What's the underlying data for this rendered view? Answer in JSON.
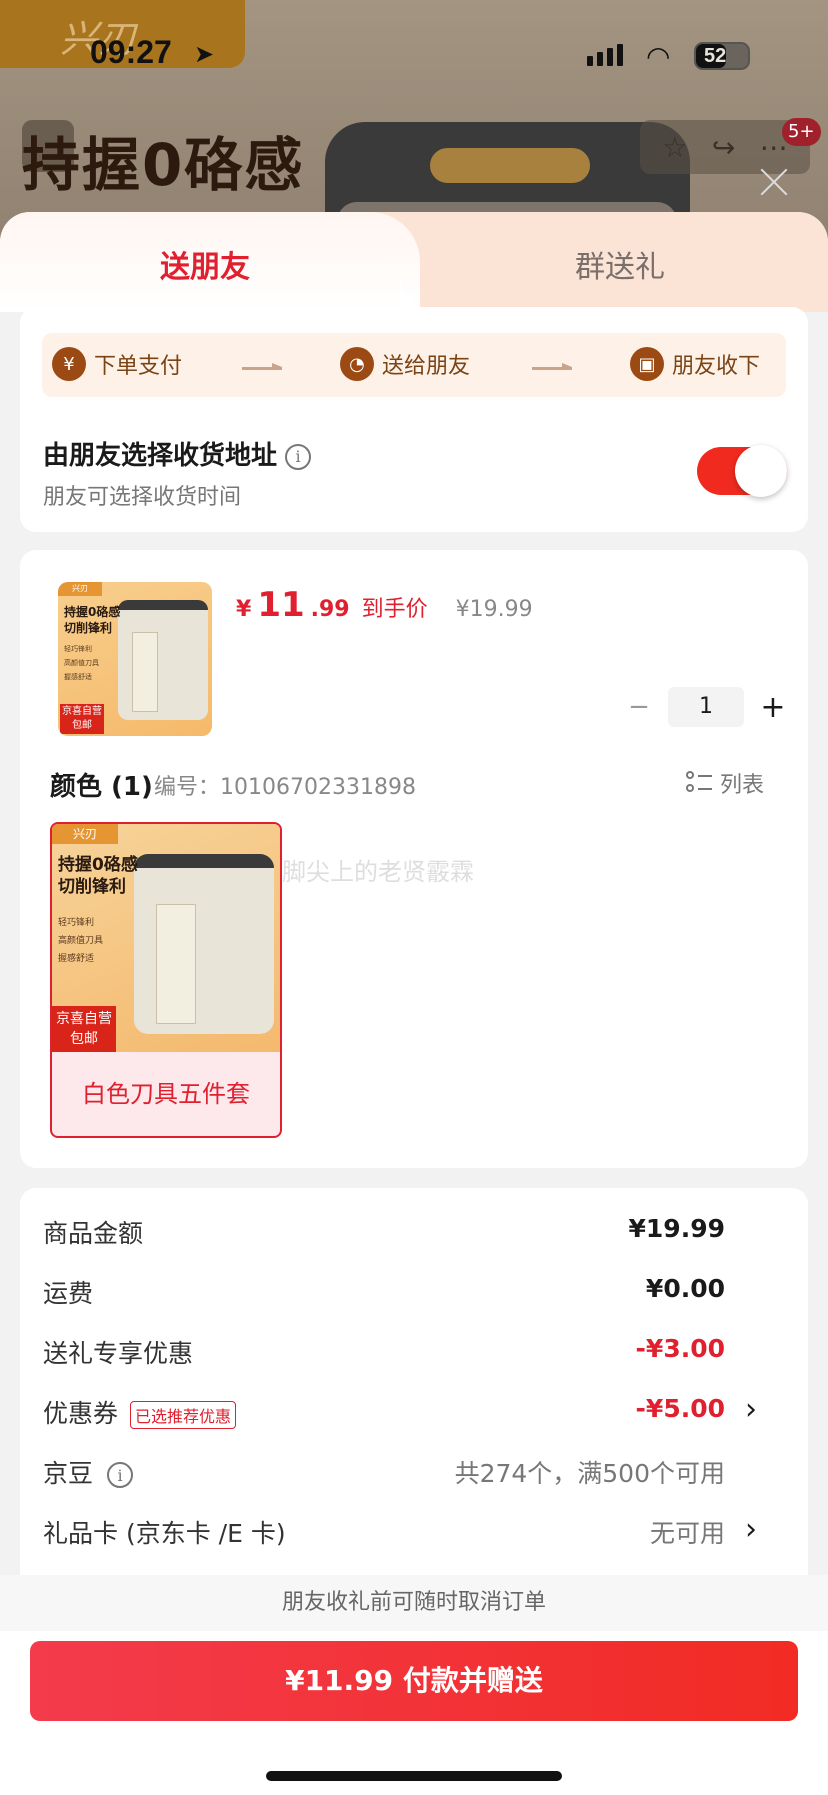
{
  "status_bar": {
    "time": "09:27",
    "battery": "52"
  },
  "background_page": {
    "brand": "兴刃",
    "headline": "持握0硌感",
    "notif_badge": "5+"
  },
  "tabs": [
    {
      "label": "送朋友",
      "active": true
    },
    {
      "label": "群送礼",
      "active": false
    }
  ],
  "flow_steps": [
    {
      "label": "下单支付",
      "icon": "yen-icon"
    },
    {
      "label": "送给朋友",
      "icon": "wechat-icon"
    },
    {
      "label": "朋友收下",
      "icon": "gift-icon"
    }
  ],
  "address": {
    "title": "由朋友选择收货地址",
    "subtitle": "朋友可选择收货时间",
    "toggle_on": true
  },
  "product": {
    "thumb_brand": "兴刃",
    "thumb_headline": "持握0硌感\n切削锋利",
    "thumb_features": "轻巧锋利\n高颜值刀具\n握感舒适",
    "thumb_badge": "京喜自营\n包邮",
    "price_symbol": "¥",
    "price_int": "11",
    "price_dec": ".99",
    "price_label": "到手价",
    "price_original": "¥19.99",
    "quantity": "1"
  },
  "spec": {
    "title": "颜色 (1)",
    "code": "编号：10106702331898",
    "list_label": "列表",
    "variants": [
      {
        "label": "白色刀具五件套",
        "selected": true
      }
    ],
    "watermark": "脚尖上的老贤霰霖"
  },
  "fees": [
    {
      "label": "商品金额",
      "value": "¥19.99",
      "style": "dark",
      "chevron": false
    },
    {
      "label": "运费",
      "value": "¥0.00",
      "style": "dark",
      "chevron": false
    },
    {
      "label": "送礼专享优惠",
      "value": "-¥3.00",
      "style": "red",
      "chevron": false
    },
    {
      "label": "优惠券",
      "tag": "已选推荐优惠",
      "value": "-¥5.00",
      "style": "red",
      "chevron": true
    },
    {
      "label": "京豆",
      "info": true,
      "value": "共274个，满500个可用",
      "style": "gray",
      "chevron": false
    },
    {
      "label": "礼品卡 (京东卡 /E 卡)",
      "value": "无可用",
      "style": "gray",
      "chevron": true
    }
  ],
  "footer": {
    "note": "朋友收礼前可随时取消订单",
    "pay_button": "¥11.99 付款并赠送"
  },
  "colors": {
    "accent": "#e0202e",
    "tab_bg": "#fbe3d6",
    "step_bg": "#fdf1e8"
  }
}
